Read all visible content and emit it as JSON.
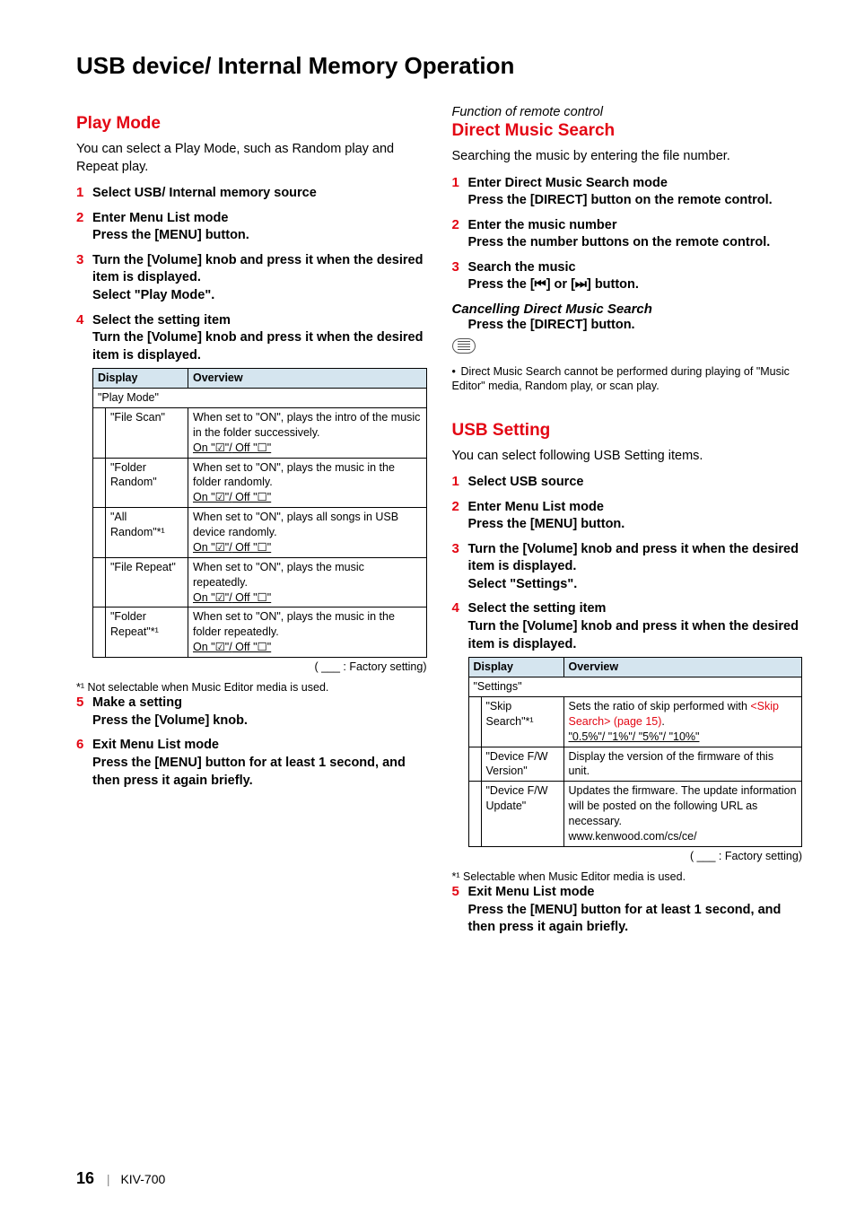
{
  "pageTitle": "USB device/ Internal Memory Operation",
  "left": {
    "heading": "Play Mode",
    "intro": "You can select a Play Mode, such as Random play and Repeat play.",
    "steps": [
      {
        "title": "Select USB/ Internal memory source"
      },
      {
        "title": "Enter Menu List mode",
        "sub": "Press the [MENU] button."
      },
      {
        "title": "Turn the [Volume] knob and press it when the desired item is displayed.",
        "sub": "Select \"Play Mode\"."
      },
      {
        "title": "Select the setting item",
        "sub": "Turn the [Volume] knob and press it when the desired item is displayed."
      }
    ],
    "table": {
      "header": {
        "c1": "Display",
        "c2": "Overview"
      },
      "groupRow": "\"Play Mode\"",
      "rows": [
        {
          "name": "\"File Scan\"",
          "desc": "When set to \"ON\", plays the intro of the music in the folder successively.",
          "opts": {
            "on": "On \"☑\"/",
            "off": " Off \"☐\""
          }
        },
        {
          "name": "\"Folder Random\"",
          "desc": "When set to \"ON\", plays the music in the folder randomly.",
          "opts": {
            "on": "On \"☑\"/",
            "off": " Off \"☐\""
          }
        },
        {
          "name": "\"All Random\"*¹",
          "desc": "When set to \"ON\", plays all songs in USB device randomly.",
          "opts": {
            "on": "On \"☑\"/",
            "off": " Off \"☐\""
          }
        },
        {
          "name": "\"File Repeat\"",
          "desc": "When set to \"ON\", plays the music repeatedly.",
          "opts": {
            "on": "On \"☑\"/",
            "off": " Off \"☐\""
          }
        },
        {
          "name": "\"Folder Repeat\"*¹",
          "desc": "When set to \"ON\", plays the music in the folder repeatedly.",
          "opts": {
            "on": "On \"☑\"/",
            "off": " Off \"☐\""
          }
        }
      ]
    },
    "factoryLegend": "( ___ : Factory setting)",
    "footnote1": "*¹ Not selectable when Music Editor media is used.",
    "steps56": [
      {
        "num": "5",
        "title": "Make a setting",
        "sub": "Press the [Volume] knob."
      },
      {
        "num": "6",
        "title": "Exit Menu List mode",
        "sub": "Press the [MENU] button for at least 1 second, and then press it again briefly."
      }
    ]
  },
  "right": {
    "fnRemote": "Function of remote control",
    "dms": {
      "heading": "Direct Music Search",
      "intro": "Searching the music by entering the file number.",
      "steps": [
        {
          "title": "Enter Direct Music Search mode",
          "sub": "Press the [DIRECT] button on the remote control."
        },
        {
          "title": "Enter the music number",
          "sub": "Press the number buttons on the remote control."
        },
        {
          "title": "Search the music",
          "sub": "Press the [⏮] or [⏭] button."
        }
      ],
      "cancelHeading": "Cancelling Direct Music Search",
      "cancelBody": "Press the [DIRECT] button.",
      "note": "Direct Music Search cannot be performed during playing of \"Music Editor\" media, Random play, or scan play."
    },
    "usb": {
      "heading": "USB Setting",
      "intro": "You can select following USB Setting items.",
      "steps": [
        {
          "title": "Select USB source"
        },
        {
          "title": "Enter Menu List mode",
          "sub": "Press the [MENU] button."
        },
        {
          "title": "Turn the [Volume] knob and press it when the desired item is displayed.",
          "sub": "Select \"Settings\"."
        },
        {
          "title": "Select the setting item",
          "sub": "Turn the [Volume] knob and press it when the desired item is displayed."
        }
      ],
      "table": {
        "header": {
          "c1": "Display",
          "c2": "Overview"
        },
        "groupRow": "\"Settings\"",
        "rows": [
          {
            "name": "\"Skip Search\"*¹",
            "descPrefix": "Sets the ratio of skip performed with ",
            "link": "<Skip Search> (page 15)",
            "descSuffix": ".",
            "opts": "\"0.5%\"/ \"1%\"/ \"5%\"/ \"10%\""
          },
          {
            "name": "\"Device F/W Version\"",
            "desc": "Display the version of the firmware of this unit."
          },
          {
            "name": "\"Device F/W Update\"",
            "desc": "Updates the firmware. The update information will be posted on the following URL as necessary.\nwww.kenwood.com/cs/ce/"
          }
        ]
      },
      "factoryLegend": "( ___ : Factory setting)",
      "footnote1": "*¹ Selectable when Music Editor media is used.",
      "step5": {
        "num": "5",
        "title": "Exit Menu List mode",
        "sub": "Press the [MENU] button for at least 1 second, and then press it again briefly."
      }
    }
  },
  "footer": {
    "page": "16",
    "model": "KIV-700"
  }
}
